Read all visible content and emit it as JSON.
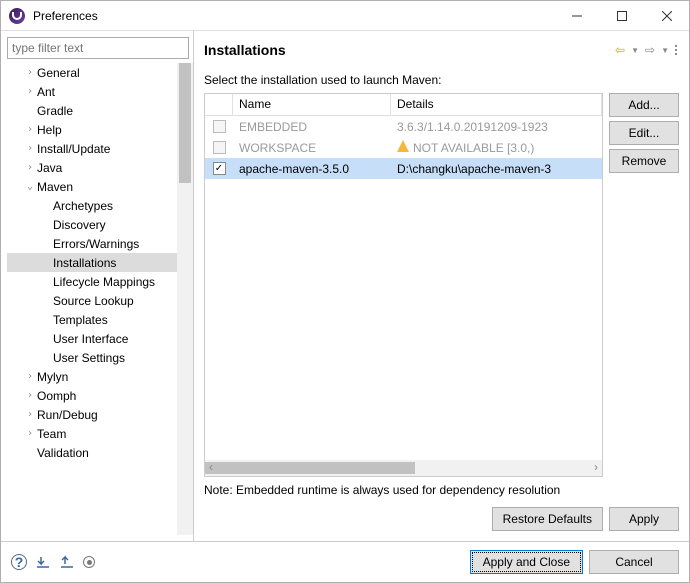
{
  "window": {
    "title": "Preferences"
  },
  "filter": {
    "placeholder": "type filter text"
  },
  "tree": [
    {
      "label": "General",
      "depth": 1,
      "exp": ">"
    },
    {
      "label": "Ant",
      "depth": 1,
      "exp": ">"
    },
    {
      "label": "Gradle",
      "depth": 1,
      "exp": ""
    },
    {
      "label": "Help",
      "depth": 1,
      "exp": ">"
    },
    {
      "label": "Install/Update",
      "depth": 1,
      "exp": ">"
    },
    {
      "label": "Java",
      "depth": 1,
      "exp": ">"
    },
    {
      "label": "Maven",
      "depth": 1,
      "exp": "v"
    },
    {
      "label": "Archetypes",
      "depth": 2,
      "exp": ""
    },
    {
      "label": "Discovery",
      "depth": 2,
      "exp": ""
    },
    {
      "label": "Errors/Warnings",
      "depth": 2,
      "exp": ""
    },
    {
      "label": "Installations",
      "depth": 2,
      "exp": "",
      "sel": true
    },
    {
      "label": "Lifecycle Mappings",
      "depth": 2,
      "exp": ""
    },
    {
      "label": "Source Lookup",
      "depth": 2,
      "exp": ""
    },
    {
      "label": "Templates",
      "depth": 2,
      "exp": ""
    },
    {
      "label": "User Interface",
      "depth": 2,
      "exp": ""
    },
    {
      "label": "User Settings",
      "depth": 2,
      "exp": ""
    },
    {
      "label": "Mylyn",
      "depth": 1,
      "exp": ">"
    },
    {
      "label": "Oomph",
      "depth": 1,
      "exp": ">"
    },
    {
      "label": "Run/Debug",
      "depth": 1,
      "exp": ">"
    },
    {
      "label": "Team",
      "depth": 1,
      "exp": ">"
    },
    {
      "label": "Validation",
      "depth": 1,
      "exp": ""
    }
  ],
  "page": {
    "title": "Installations",
    "instruction": "Select the installation used to launch Maven:",
    "columns": {
      "name": "Name",
      "details": "Details"
    },
    "rows": [
      {
        "name": "EMBEDDED",
        "details": "3.6.3/1.14.0.20191209-1923",
        "disabled": true,
        "checked": false,
        "warn": false
      },
      {
        "name": "WORKSPACE",
        "details": "NOT AVAILABLE [3.0,)",
        "disabled": true,
        "checked": false,
        "warn": true
      },
      {
        "name": "apache-maven-3.5.0",
        "details": "D:\\changku\\apache-maven-3",
        "disabled": false,
        "checked": true,
        "warn": false,
        "sel": true
      }
    ],
    "buttons": {
      "add": "Add...",
      "edit": "Edit...",
      "remove": "Remove"
    },
    "note": "Note: Embedded runtime is always used for dependency resolution",
    "restore": "Restore Defaults",
    "apply": "Apply"
  },
  "footer": {
    "applyclose": "Apply and Close",
    "cancel": "Cancel"
  }
}
